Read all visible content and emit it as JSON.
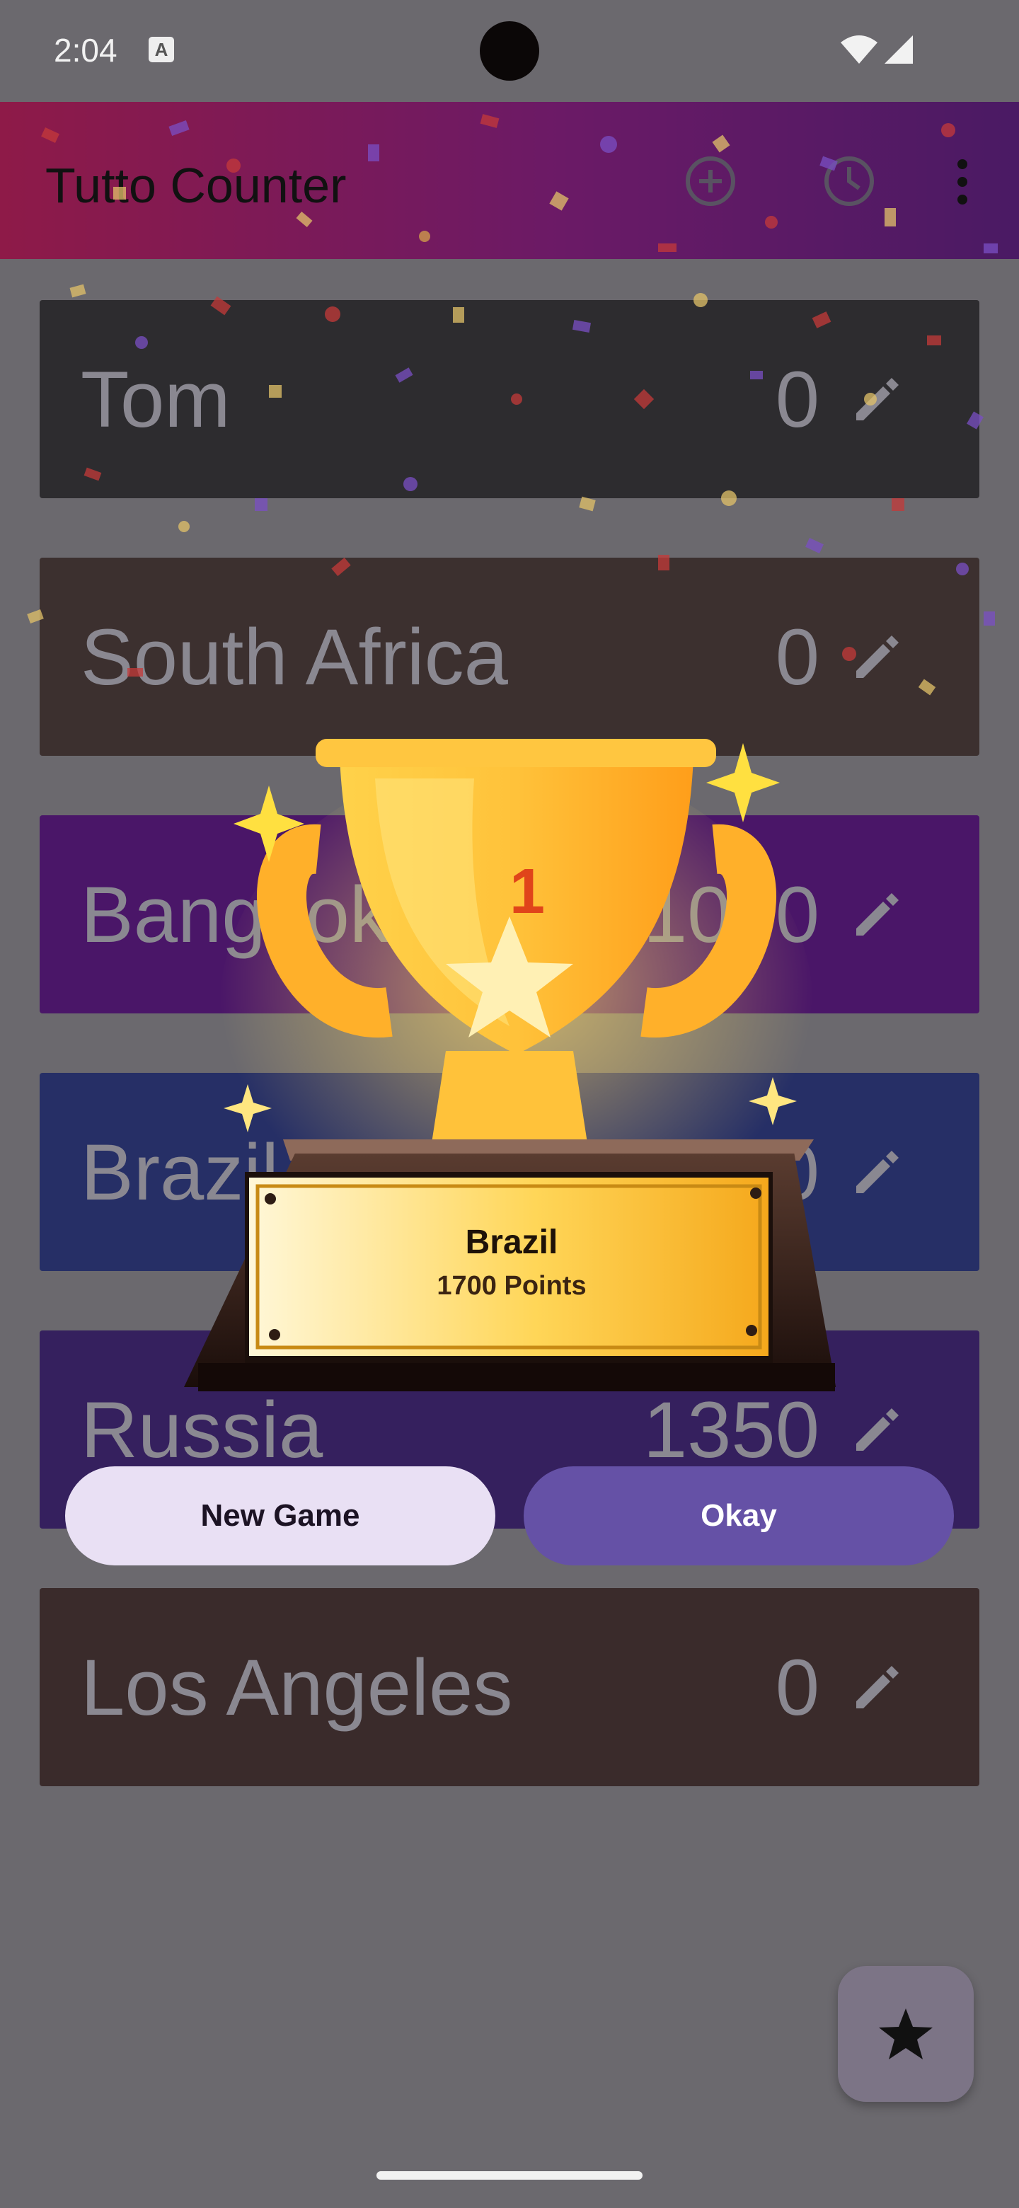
{
  "status_bar": {
    "time": "2:04",
    "notification_icon": "A"
  },
  "app_bar": {
    "title": "Tutto Counter",
    "add_icon": "add-circle-icon",
    "history_icon": "history-icon",
    "menu_icon": "more-vert-icon"
  },
  "players": [
    {
      "name": "Tom",
      "score": "0",
      "color": "#2d2c2f"
    },
    {
      "name": "South Africa",
      "score": "0",
      "color": "#3c302f"
    },
    {
      "name": "Bangkok",
      "score": "1000",
      "color": "#4a1668"
    },
    {
      "name": "Brazil",
      "score": "1700",
      "color": "#262f66"
    },
    {
      "name": "Russia",
      "score": "1350",
      "color": "#35205e"
    },
    {
      "name": "Los Angeles",
      "score": "0",
      "color": "#3a2b2b"
    }
  ],
  "dialog": {
    "rank": "1",
    "winner_name": "Brazil",
    "winner_points": "1700 Points",
    "new_game_label": "New Game",
    "okay_label": "Okay"
  },
  "fab": {
    "icon": "star-icon"
  }
}
